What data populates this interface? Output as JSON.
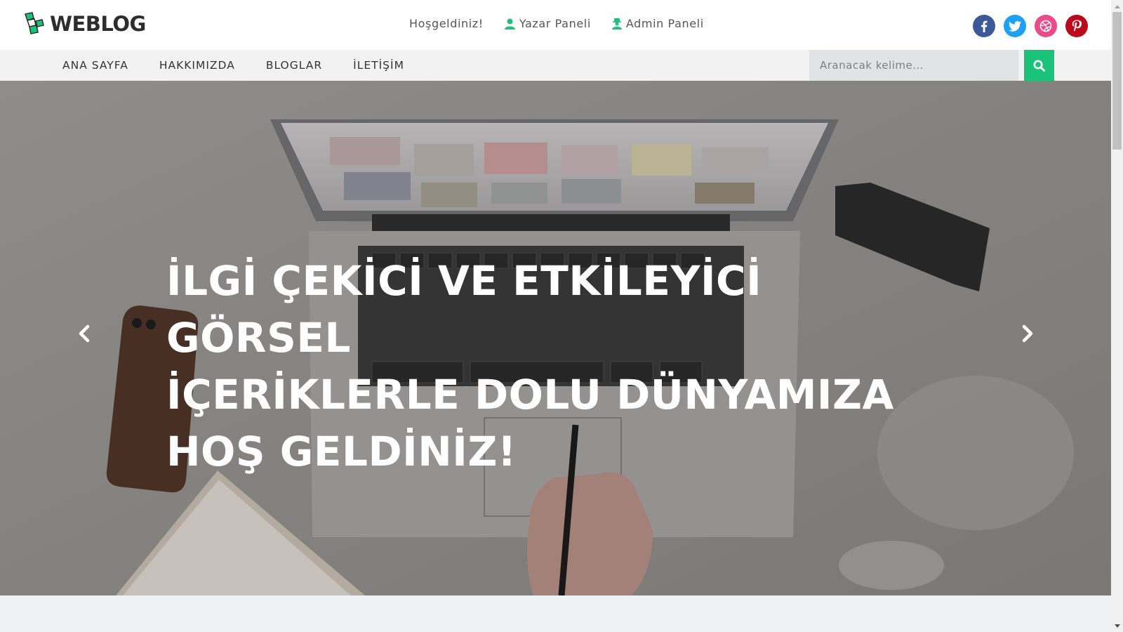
{
  "brand": {
    "name": "WEBLOG",
    "accent": "#1bc27a"
  },
  "topnav": {
    "welcome": "Hoşgeldiniz!",
    "author_panel": "Yazar Paneli",
    "admin_panel": "Admin Paneli"
  },
  "socials": [
    {
      "icon": "facebook-icon",
      "color": "#3b5998"
    },
    {
      "icon": "twitter-icon",
      "color": "#1da1f2"
    },
    {
      "icon": "dribbble-icon",
      "color": "#ea4c89"
    },
    {
      "icon": "pinterest-icon",
      "color": "#bd081c"
    }
  ],
  "menu": {
    "items": [
      "ANA SAYFA",
      "HAKKIMIZDA",
      "BLOGLAR",
      "İLETİŞİM"
    ]
  },
  "search": {
    "placeholder": "Aranacak kelime...",
    "button_icon": "search-icon"
  },
  "hero": {
    "line1": "İLGİ ÇEKİCİ VE ETKİLEYİCİ GÖRSEL",
    "line2": "İÇERİKLERLE DOLU DÜNYAMIZA",
    "line3": "HOŞ GELDİNİZ!",
    "prev_icon": "chevron-left-icon",
    "next_icon": "chevron-right-icon"
  }
}
